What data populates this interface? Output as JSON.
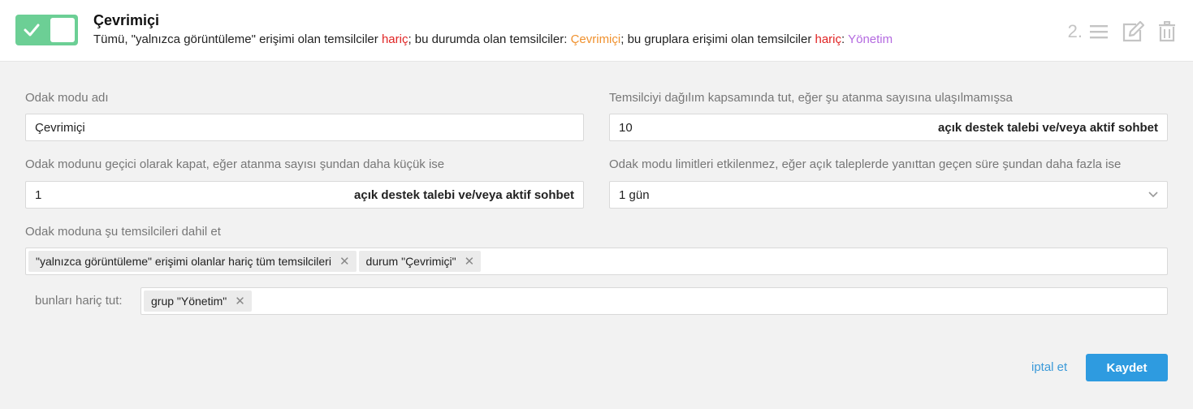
{
  "header": {
    "title": "Çevrimiçi",
    "desc": {
      "part1": "Tümü, \"yalnızca görüntüleme\" erişimi olan temsilciler ",
      "excl1": "hariç",
      "part2": "; bu durumda olan temsilciler: ",
      "status": "Çevrimiçi",
      "part3": "; bu gruplara erişimi olan temsilciler ",
      "excl2": "hariç",
      "part4": ": ",
      "group": "Yönetim"
    },
    "order": "2.",
    "icons": [
      "drag-handle-icon",
      "edit-icon",
      "trash-icon"
    ]
  },
  "form": {
    "name_label": "Odak modu adı",
    "name_value": "Çevrimiçi",
    "keep_label": "Temsilciyi dağılım kapsamında tut, eğer şu atanma sayısına ulaşılmamışsa",
    "keep_value": "10",
    "keep_suffix": "açık destek talebi ve/veya aktif sohbet",
    "pause_label": "Odak modunu geçici olarak kapat, eğer atanma sayısı şundan daha küçük ise",
    "pause_value": "1",
    "pause_suffix": "açık destek talebi ve/veya aktif sohbet",
    "limit_label": "Odak modu limitleri etkilenmez, eğer açık taleplerde yanıttan geçen süre şundan daha fazla ise",
    "limit_value": "1 gün",
    "include_label": "Odak moduna şu temsilcileri dahil et",
    "include_tags": [
      "\"yalnızca görüntüleme\" erişimi olanlar hariç tüm temsilcileri",
      "durum \"Çevrimiçi\""
    ],
    "exclude_label": "bunları hariç tut:",
    "exclude_tags": [
      "grup \"Yönetim\""
    ],
    "tag_remove": "✕"
  },
  "actions": {
    "cancel": "iptal et",
    "save": "Kaydet"
  },
  "colors": {
    "toggle_on": "#6ccf95",
    "excluded": "#e02424",
    "status": "#f0912e",
    "group": "#b46ae0",
    "primary": "#2e9be0"
  }
}
